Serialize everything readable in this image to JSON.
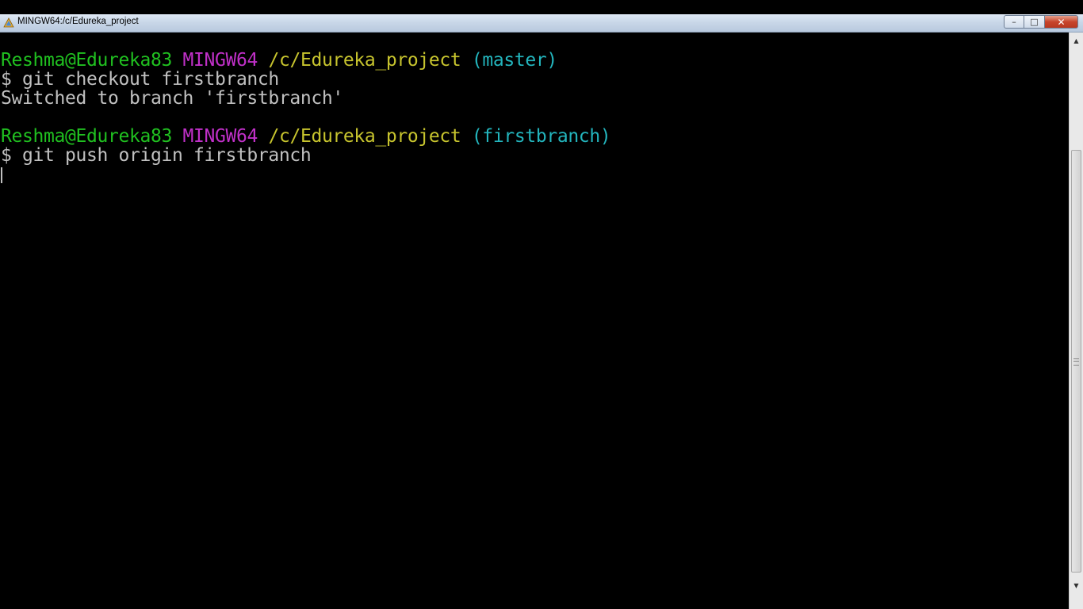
{
  "window": {
    "title": "MINGW64:/c/Edureka_project",
    "controls": {
      "minimize": "–",
      "maximize": "□",
      "close": "✕"
    }
  },
  "terminal": {
    "prompt1": {
      "user": "Reshma@Edureka83",
      "host": "MINGW64",
      "path": "/c/Edureka_project",
      "branch": "(master)"
    },
    "command1": "$ git checkout firstbranch",
    "output1": "Switched to branch 'firstbranch'",
    "prompt2": {
      "user": "Reshma@Edureka83",
      "host": "MINGW64",
      "path": "/c/Edureka_project",
      "branch": "(firstbranch)"
    },
    "command2": "$ git push origin firstbranch"
  },
  "colors": {
    "user": "#20c020",
    "host": "#c030c8",
    "path": "#c7c42e",
    "branch": "#23b5bd",
    "text": "#c0c0c0",
    "background": "#000000"
  },
  "scrollbar": {
    "up_arrow": "▲",
    "down_arrow": "▼"
  }
}
